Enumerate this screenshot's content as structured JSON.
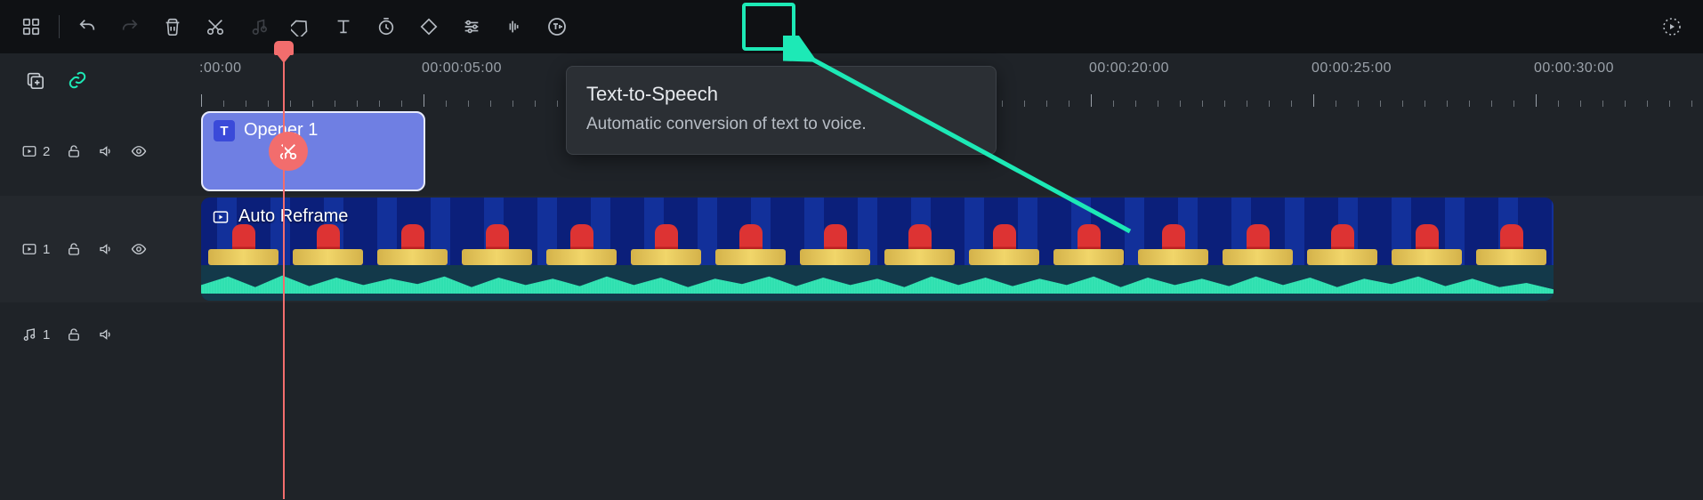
{
  "toolbar": {
    "icons": [
      "apps",
      "undo",
      "redo",
      "delete",
      "cut",
      "music-note",
      "tag",
      "text",
      "timer",
      "keyframe",
      "sliders",
      "audio-spectrum",
      "text-to-speech",
      "render-preview"
    ],
    "highlighted_icon": "text-to-speech"
  },
  "tooltip": {
    "title": "Text-to-Speech",
    "body": "Automatic conversion of text to voice."
  },
  "ruler": {
    "labels": [
      {
        "text": ":00:00",
        "pos": 0
      },
      {
        "text": "00:00:05:00",
        "pos": 250
      },
      {
        "text": "00:00:20:00",
        "pos": 1000
      },
      {
        "text": "00:00:25:00",
        "pos": 1250
      },
      {
        "text": "00:00:30:00",
        "pos": 1500
      }
    ]
  },
  "tracks": {
    "video2": {
      "label": "2",
      "clip_label": "Opener 1"
    },
    "video1": {
      "label": "1",
      "clip_label": "Auto Reframe"
    },
    "audio1": {
      "label": "1"
    }
  }
}
